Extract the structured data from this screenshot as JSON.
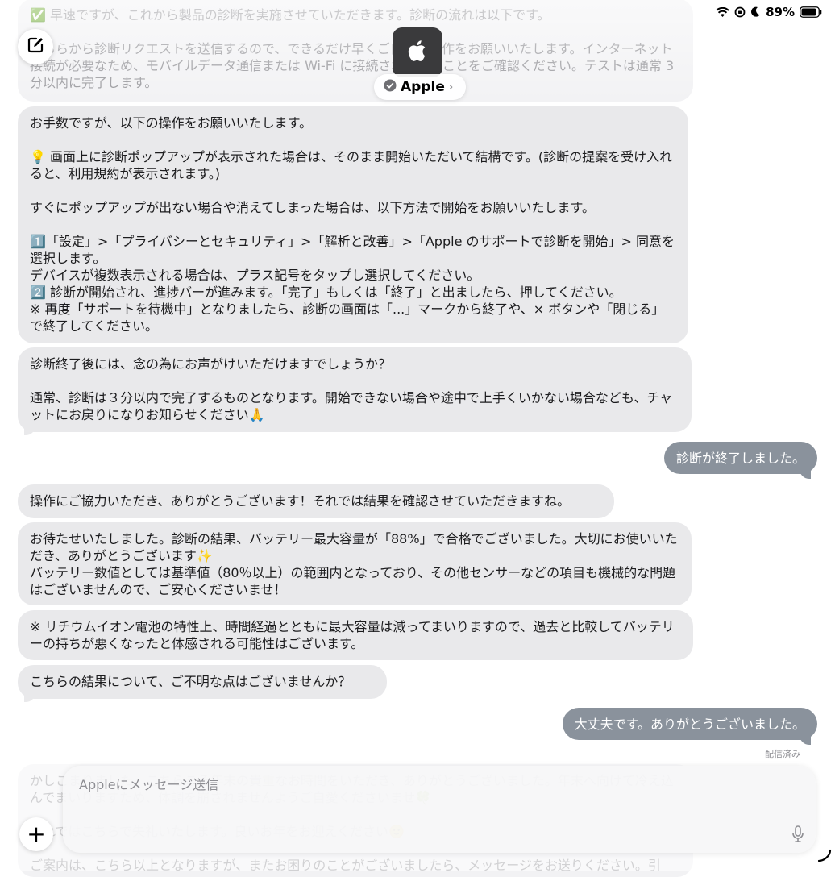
{
  "status_bar": {
    "battery": "89%"
  },
  "header": {
    "contact_name": "Apple",
    "chevron": "›",
    "compose_icon": "compose-icon",
    "avatar_icon": "apple-logo-icon",
    "verified_icon": "verified-badge-icon"
  },
  "messages": [
    {
      "dir": "in",
      "faded": true,
      "text": "✅ 早速ですが、これから製品の診断を実施させていただきます。診断の流れは以下です。\n\nこちらから診断リクエストを送信するので、できるだけ早くご自身で操作をお願いいたします。インターネット接続が必要なため、モバイルデータ通信または Wi-Fi に接続されていることをご確認ください。テストは通常 3 分以内に完了します。"
    },
    {
      "dir": "in",
      "text": "お手数ですが、以下の操作をお願いいたします。\n\n💡 画面上に診断ポップアップが表示された場合は、そのまま開始いただいて結構です。(診断の提案を受け入れると、利用規約が表示されます。)\n\nすぐにポップアップが出ない場合や消えてしまった場合は、以下方法で開始をお願いいたします。\n\n1️⃣「設定」>「プライバシーとセキュリティ」>「解析と改善」>「Apple のサポートで診断を開始」> 同意を選択します。\nデバイスが複数表示される場合は、プラス記号をタップし選択してください。\n2️⃣ 診断が開始され、進捗バーが進みます。「完了」もしくは「終了」と出ましたら、押してください。\n※ 再度「サポートを待機中」となりましたら、診断の画面は「...」マークから終了や、× ボタンや「閉じる」で終了してください。"
    },
    {
      "dir": "in",
      "text": "診断終了後には、念の為にお声がけいただけますでしょうか？\n\n通常、診断は３分以内で完了するものとなります。開始できない場合や途中で上手くいかない場合なども、チャットにお戻りになりお知らせください🙏"
    },
    {
      "dir": "out",
      "text": "診断が終了しました。"
    },
    {
      "dir": "in",
      "text": "操作にご協力いただき、ありがとうございます！それでは結果を確認させていただきますね。"
    },
    {
      "dir": "in",
      "text": "お待たせいたしました。診断の結果、バッテリー最大容量が「88%」で合格でございました。大切にお使いいただき、ありがとうございます✨\nバッテリー数値としては基準値（80％以上）の範囲内となっており、その他センサーなどの項目も機械的な問題はございませんので、ご安心くださいませ！"
    },
    {
      "dir": "in",
      "text": "※ リチウムイオン電池の特性上、時間経過とともに最大容量は減ってまいりますので、過去と比較してバッテリーの持ちが悪くなったと体感される可能性はございます。"
    },
    {
      "dir": "in",
      "text": "こちらの結果について、ご不明な点はございませんか？"
    },
    {
      "dir": "out",
      "text": "大丈夫です。ありがとうございました。"
    },
    {
      "dir": "in",
      "faded": true,
      "text": "かしこまりました。こちらこそ年末の貴重なお時間をいただき、ありがとうございました。年末へ向けて冷え込んでまいりますため、体調を崩されませんようご自愛くださいませ🍀\n\nそれではこちらで失礼いたします。良いお年をお迎えください🙂\n\nご案内は、こちら以上となりますが、またお困りのことがございましたら、メッセージをお送りください。引"
    }
  ],
  "delivered_label": "配信済み",
  "composer": {
    "placeholder": "Appleにメッセージ送信",
    "plus_label": "+",
    "mic_icon": "microphone-icon"
  }
}
